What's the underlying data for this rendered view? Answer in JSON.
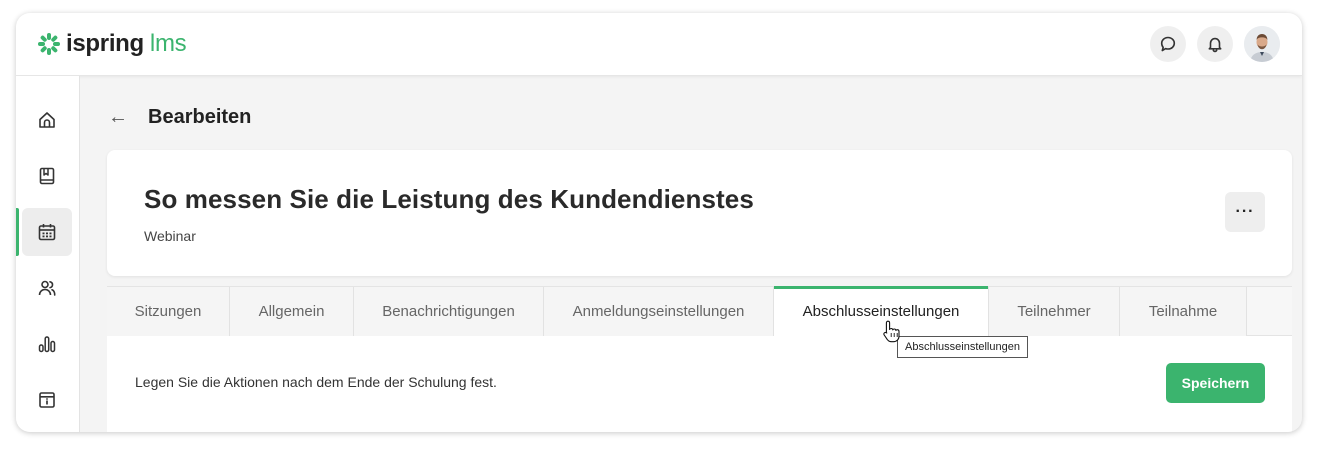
{
  "app": {
    "logo_word1": "ispring",
    "logo_word2": "lms",
    "brand_color": "#3bb46e"
  },
  "topbar": {
    "icons": [
      "chat-icon",
      "bell-icon"
    ],
    "avatar": "user-avatar"
  },
  "sidebar": {
    "items": [
      {
        "icon": "home-icon",
        "active": false
      },
      {
        "icon": "book-icon",
        "active": false
      },
      {
        "icon": "calendar-icon",
        "active": true
      },
      {
        "icon": "users-icon",
        "active": false
      },
      {
        "icon": "chart-icon",
        "active": false
      },
      {
        "icon": "info-archive-icon",
        "active": false
      }
    ]
  },
  "header": {
    "back_icon": "←",
    "title": "Bearbeiten"
  },
  "course": {
    "title": "So messen Sie die Leistung des Kundendienstes",
    "type": "Webinar",
    "more_label": "···"
  },
  "tabs": [
    {
      "label": "Sitzungen",
      "active": false
    },
    {
      "label": "Allgemein",
      "active": false
    },
    {
      "label": "Benachrichtigungen",
      "active": false
    },
    {
      "label": "Anmeldungseinstellungen",
      "active": false
    },
    {
      "label": "Abschlusseinstellungen",
      "active": true
    },
    {
      "label": "Teilnehmer",
      "active": false
    },
    {
      "label": "Teilnahme",
      "active": false
    }
  ],
  "content": {
    "description": "Legen Sie die Aktionen nach dem Ende der Schulung fest.",
    "save_label": "Speichern"
  },
  "tooltip": {
    "text": "Abschlusseinstellungen"
  }
}
